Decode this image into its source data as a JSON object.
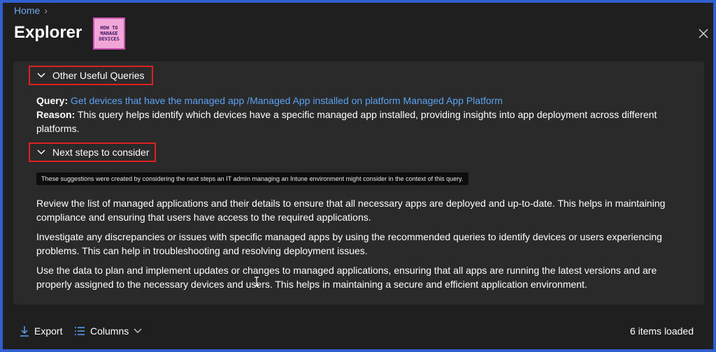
{
  "breadcrumb": {
    "home": "Home"
  },
  "header": {
    "title": "Explorer",
    "logo_line1": "HOW TO",
    "logo_line2": "MANAGE",
    "logo_line3": "DEVICES"
  },
  "sections": {
    "queries": {
      "label": "Other Useful Queries",
      "query_label": "Query:",
      "query_link": "Get devices that have the managed app /Managed App installed on platform Managed App Platform",
      "reason_label": "Reason:",
      "reason_text_1": "This query helps identify which devices have a specific managed app installed, providing insights into app deployment across different",
      "reason_text_2": "platforms."
    },
    "next_steps": {
      "label": "Next steps to consider",
      "tooltip": "These suggestions were created by considering the next steps an IT admin managing an Intune environment might consider in the context of this query.",
      "para1_line1": "Review the list of managed applications and their details to ensure that all necessary apps are deployed and up-to-date. This helps in maintaining",
      "para1_line2": "compliance and ensuring that users have access to the required applications.",
      "para2_line1": "Investigate any discrepancies or issues with specific managed apps by using the recommended queries to identify devices or users experiencing",
      "para2_line2": "problems. This can help in troubleshooting and resolving deployment issues.",
      "para3_line1": "Use the data to plan and implement updates or changes to managed applications, ensuring that all apps are running the latest versions and are",
      "para3_line2": "properly assigned to the necessary devices and users. This helps in maintaining a secure and efficient application environment."
    }
  },
  "footer": {
    "export_label": "Export",
    "columns_label": "Columns",
    "items_loaded": "6 items loaded"
  },
  "icons": {
    "close": "close-icon",
    "export": "download-icon",
    "columns": "list-icon",
    "chevron": "chevron-down-icon"
  },
  "colors": {
    "accent": "#5aa2f2",
    "highlight_border": "#e02020",
    "background": "#1f1f1f",
    "panel": "#2a2a2a"
  }
}
